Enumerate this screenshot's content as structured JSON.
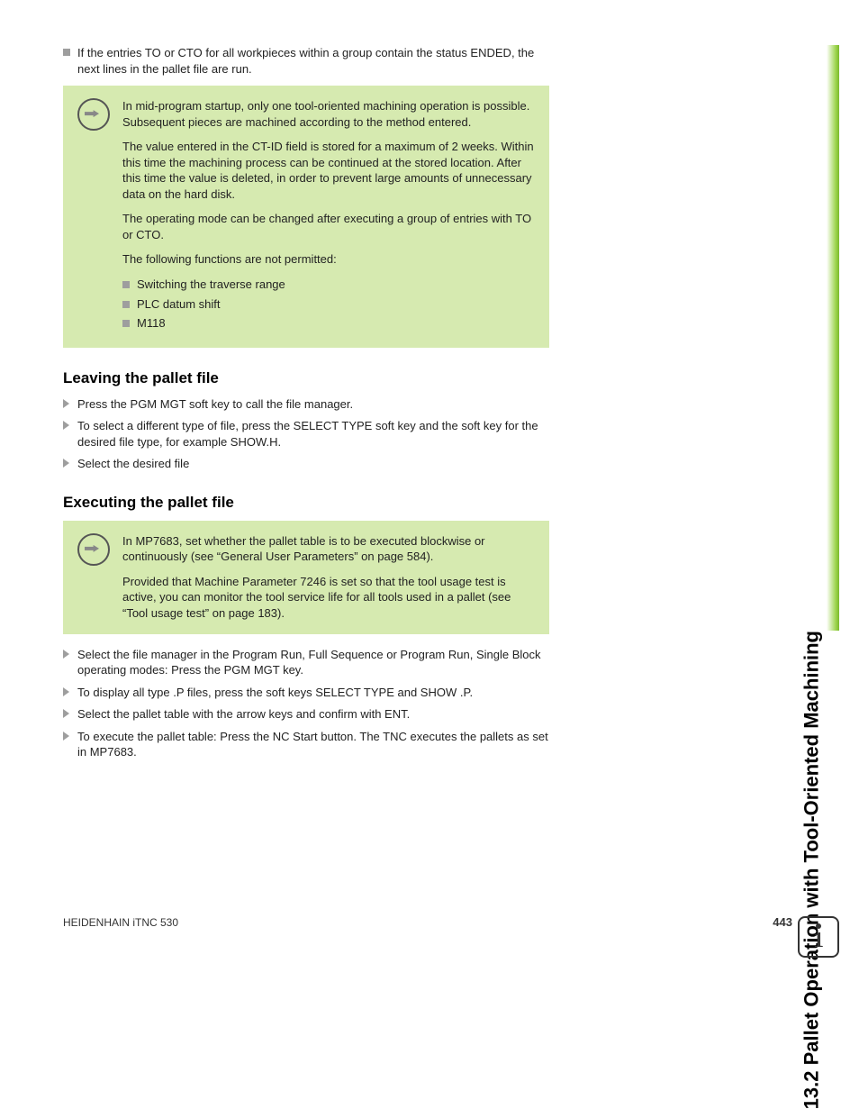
{
  "sidebar_title": "13.2 Pallet Operation with Tool-Oriented Machining",
  "intro_bullet": "If the entries TO or CTO for all workpieces within a group contain the status ENDED, the next lines in the pallet file are run.",
  "note1": {
    "p1": "In mid-program startup, only one tool-oriented machining operation is possible. Subsequent pieces are machined according to the method entered.",
    "p2": "The value entered in the CT-ID field is stored for a maximum of 2 weeks. Within this time the machining process can be continued at the stored location. After this time the value is deleted, in order to prevent large amounts of unnecessary data on the hard disk.",
    "p3": "The operating mode can be changed after executing a group of entries with TO or CTO.",
    "p4": "The following functions are not permitted:",
    "items": [
      "Switching the traverse range",
      "PLC datum shift",
      "M118"
    ]
  },
  "section1": {
    "title": "Leaving the pallet file",
    "items": [
      "Press the PGM MGT soft key to call the file manager.",
      "To select a different type of file, press the SELECT TYPE soft key and the soft key for the desired file type, for example SHOW.H.",
      "Select the desired file"
    ]
  },
  "section2": {
    "title": "Executing the pallet file",
    "note": {
      "p1": "In MP7683, set whether the pallet table is to be executed blockwise or continuously (see “General User Parameters” on page 584).",
      "p2": "Provided that Machine Parameter 7246 is set so that the tool usage test is active, you can monitor the tool service life for all tools used in a pallet (see “Tool usage test” on page 183)."
    },
    "items": [
      "Select the file manager in the Program Run, Full Sequence or Program Run, Single Block operating modes: Press the PGM MGT key.",
      "To display all type .P files, press the soft keys SELECT TYPE and SHOW .P.",
      "Select the pallet table with the arrow keys and confirm with ENT.",
      "To execute the pallet table: Press the NC Start button. The TNC executes the pallets as set in MP7683."
    ]
  },
  "footer": {
    "left": "HEIDENHAIN iTNC 530",
    "page": "443"
  },
  "info_glyph": "1"
}
